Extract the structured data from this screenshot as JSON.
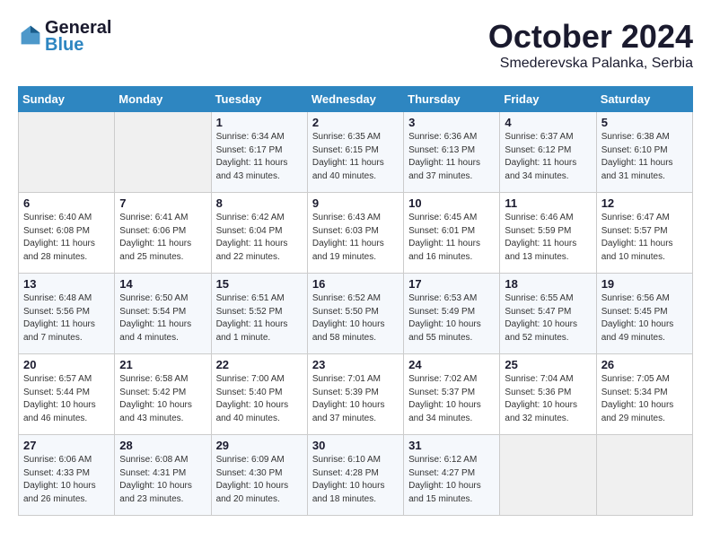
{
  "header": {
    "logo_line1": "General",
    "logo_line2": "Blue",
    "month": "October 2024",
    "location": "Smederevska Palanka, Serbia"
  },
  "weekdays": [
    "Sunday",
    "Monday",
    "Tuesday",
    "Wednesday",
    "Thursday",
    "Friday",
    "Saturday"
  ],
  "weeks": [
    [
      {
        "day": "",
        "info": ""
      },
      {
        "day": "",
        "info": ""
      },
      {
        "day": "1",
        "info": "Sunrise: 6:34 AM\nSunset: 6:17 PM\nDaylight: 11 hours and 43 minutes."
      },
      {
        "day": "2",
        "info": "Sunrise: 6:35 AM\nSunset: 6:15 PM\nDaylight: 11 hours and 40 minutes."
      },
      {
        "day": "3",
        "info": "Sunrise: 6:36 AM\nSunset: 6:13 PM\nDaylight: 11 hours and 37 minutes."
      },
      {
        "day": "4",
        "info": "Sunrise: 6:37 AM\nSunset: 6:12 PM\nDaylight: 11 hours and 34 minutes."
      },
      {
        "day": "5",
        "info": "Sunrise: 6:38 AM\nSunset: 6:10 PM\nDaylight: 11 hours and 31 minutes."
      }
    ],
    [
      {
        "day": "6",
        "info": "Sunrise: 6:40 AM\nSunset: 6:08 PM\nDaylight: 11 hours and 28 minutes."
      },
      {
        "day": "7",
        "info": "Sunrise: 6:41 AM\nSunset: 6:06 PM\nDaylight: 11 hours and 25 minutes."
      },
      {
        "day": "8",
        "info": "Sunrise: 6:42 AM\nSunset: 6:04 PM\nDaylight: 11 hours and 22 minutes."
      },
      {
        "day": "9",
        "info": "Sunrise: 6:43 AM\nSunset: 6:03 PM\nDaylight: 11 hours and 19 minutes."
      },
      {
        "day": "10",
        "info": "Sunrise: 6:45 AM\nSunset: 6:01 PM\nDaylight: 11 hours and 16 minutes."
      },
      {
        "day": "11",
        "info": "Sunrise: 6:46 AM\nSunset: 5:59 PM\nDaylight: 11 hours and 13 minutes."
      },
      {
        "day": "12",
        "info": "Sunrise: 6:47 AM\nSunset: 5:57 PM\nDaylight: 11 hours and 10 minutes."
      }
    ],
    [
      {
        "day": "13",
        "info": "Sunrise: 6:48 AM\nSunset: 5:56 PM\nDaylight: 11 hours and 7 minutes."
      },
      {
        "day": "14",
        "info": "Sunrise: 6:50 AM\nSunset: 5:54 PM\nDaylight: 11 hours and 4 minutes."
      },
      {
        "day": "15",
        "info": "Sunrise: 6:51 AM\nSunset: 5:52 PM\nDaylight: 11 hours and 1 minute."
      },
      {
        "day": "16",
        "info": "Sunrise: 6:52 AM\nSunset: 5:50 PM\nDaylight: 10 hours and 58 minutes."
      },
      {
        "day": "17",
        "info": "Sunrise: 6:53 AM\nSunset: 5:49 PM\nDaylight: 10 hours and 55 minutes."
      },
      {
        "day": "18",
        "info": "Sunrise: 6:55 AM\nSunset: 5:47 PM\nDaylight: 10 hours and 52 minutes."
      },
      {
        "day": "19",
        "info": "Sunrise: 6:56 AM\nSunset: 5:45 PM\nDaylight: 10 hours and 49 minutes."
      }
    ],
    [
      {
        "day": "20",
        "info": "Sunrise: 6:57 AM\nSunset: 5:44 PM\nDaylight: 10 hours and 46 minutes."
      },
      {
        "day": "21",
        "info": "Sunrise: 6:58 AM\nSunset: 5:42 PM\nDaylight: 10 hours and 43 minutes."
      },
      {
        "day": "22",
        "info": "Sunrise: 7:00 AM\nSunset: 5:40 PM\nDaylight: 10 hours and 40 minutes."
      },
      {
        "day": "23",
        "info": "Sunrise: 7:01 AM\nSunset: 5:39 PM\nDaylight: 10 hours and 37 minutes."
      },
      {
        "day": "24",
        "info": "Sunrise: 7:02 AM\nSunset: 5:37 PM\nDaylight: 10 hours and 34 minutes."
      },
      {
        "day": "25",
        "info": "Sunrise: 7:04 AM\nSunset: 5:36 PM\nDaylight: 10 hours and 32 minutes."
      },
      {
        "day": "26",
        "info": "Sunrise: 7:05 AM\nSunset: 5:34 PM\nDaylight: 10 hours and 29 minutes."
      }
    ],
    [
      {
        "day": "27",
        "info": "Sunrise: 6:06 AM\nSunset: 4:33 PM\nDaylight: 10 hours and 26 minutes."
      },
      {
        "day": "28",
        "info": "Sunrise: 6:08 AM\nSunset: 4:31 PM\nDaylight: 10 hours and 23 minutes."
      },
      {
        "day": "29",
        "info": "Sunrise: 6:09 AM\nSunset: 4:30 PM\nDaylight: 10 hours and 20 minutes."
      },
      {
        "day": "30",
        "info": "Sunrise: 6:10 AM\nSunset: 4:28 PM\nDaylight: 10 hours and 18 minutes."
      },
      {
        "day": "31",
        "info": "Sunrise: 6:12 AM\nSunset: 4:27 PM\nDaylight: 10 hours and 15 minutes."
      },
      {
        "day": "",
        "info": ""
      },
      {
        "day": "",
        "info": ""
      }
    ]
  ]
}
